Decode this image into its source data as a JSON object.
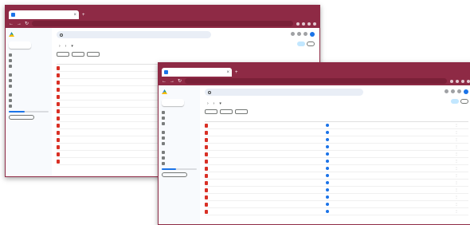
{
  "colors": {
    "chrome": "#8e2a45",
    "chrome_dark": "#7a2038",
    "sidebar_bg": "#f8fafd",
    "doc_icon": "#d93025",
    "owner_avatar": "#1a73e8"
  },
  "icons": {
    "app_logo": "triangle-logo-icon",
    "doc": "pdf-doc-icon",
    "owner": "avatar-dot-icon",
    "row_menu": "more-vert-icon"
  },
  "back_window": {
    "tab_label": "",
    "url": "",
    "app_name": "",
    "new_label": "",
    "search_placeholder": "",
    "nav_items": [
      {
        "label": ""
      },
      {
        "label": ""
      },
      {
        "label": ""
      },
      {
        "label": ""
      },
      {
        "label": ""
      },
      {
        "label": ""
      },
      {
        "label": ""
      },
      {
        "label": ""
      },
      {
        "label": ""
      }
    ],
    "storage_text": "",
    "buy_storage_label": "",
    "breadcrumb": [
      "",
      "",
      ""
    ],
    "chips": [
      "",
      "",
      ""
    ],
    "columns": {
      "name": ""
    },
    "files": [
      {
        "name": ""
      },
      {
        "name": ""
      },
      {
        "name": ""
      },
      {
        "name": ""
      },
      {
        "name": ""
      },
      {
        "name": ""
      },
      {
        "name": ""
      },
      {
        "name": ""
      },
      {
        "name": ""
      },
      {
        "name": ""
      },
      {
        "name": ""
      },
      {
        "name": ""
      },
      {
        "name": ""
      },
      {
        "name": ""
      }
    ]
  },
  "front_window": {
    "tab_label": "",
    "url": "",
    "app_name": "",
    "new_label": "",
    "search_placeholder": "",
    "nav_items": [
      {
        "label": ""
      },
      {
        "label": ""
      },
      {
        "label": ""
      },
      {
        "label": ""
      },
      {
        "label": ""
      },
      {
        "label": ""
      },
      {
        "label": ""
      },
      {
        "label": ""
      },
      {
        "label": ""
      }
    ],
    "storage_text": "",
    "buy_storage_label": "",
    "breadcrumb": [
      "",
      "",
      ""
    ],
    "chips": [
      "",
      "",
      ""
    ],
    "columns": {
      "name": "",
      "owner": "",
      "modified": "",
      "size": ""
    },
    "files": [
      {
        "name": "",
        "modified": "",
        "size": ""
      },
      {
        "name": "",
        "modified": "",
        "size": ""
      },
      {
        "name": "",
        "modified": "",
        "size": ""
      },
      {
        "name": "",
        "modified": "",
        "size": ""
      },
      {
        "name": "",
        "modified": "",
        "size": ""
      },
      {
        "name": "",
        "modified": "",
        "size": ""
      },
      {
        "name": "",
        "modified": "",
        "size": ""
      },
      {
        "name": "",
        "modified": "",
        "size": ""
      },
      {
        "name": "",
        "modified": "",
        "size": ""
      },
      {
        "name": "",
        "modified": "",
        "size": ""
      },
      {
        "name": "",
        "modified": "",
        "size": ""
      },
      {
        "name": "",
        "modified": "",
        "size": ""
      },
      {
        "name": "",
        "modified": "",
        "size": ""
      }
    ]
  }
}
